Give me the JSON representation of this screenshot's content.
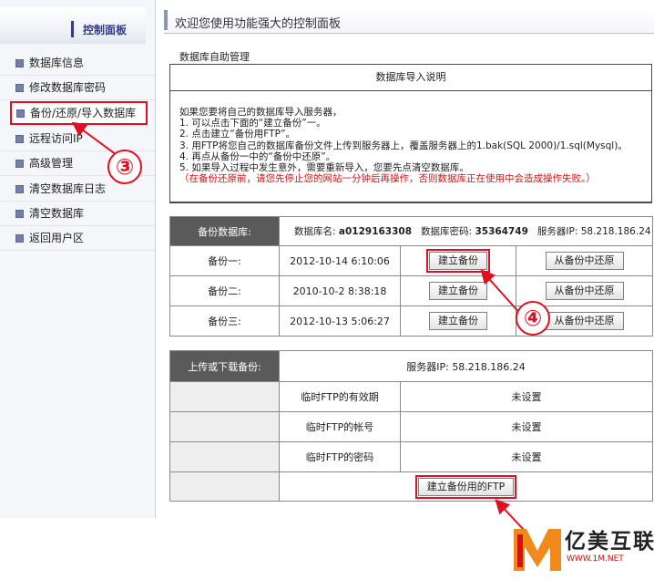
{
  "sidebar": {
    "title": "控制面板",
    "items": [
      {
        "label": "数据库信息"
      },
      {
        "label": "修改数据库密码"
      },
      {
        "label": "备份/还原/导入数据库"
      },
      {
        "label": "远程访问IP"
      },
      {
        "label": "高级管理"
      },
      {
        "label": "清空数据库日志"
      },
      {
        "label": "清空数据库"
      },
      {
        "label": "返回用户区"
      }
    ]
  },
  "header": {
    "title": "欢迎您使用功能强大的控制面板"
  },
  "section_title": "数据库自助管理",
  "import_info": {
    "heading": "数据库导入说明",
    "lines": [
      "如果您要将自己的数据库导入服务器，",
      "1. 可以点击下面的“建立备份”一。",
      "2. 点击建立“备份用FTP”。",
      "3. 用FTP将您自己的数据库备份文件上传到服务器上，覆盖服务器上的1.bak(SQL 2000)/1.sql(Mysql)。",
      "4. 再点从备份一中的“备份中还原”。",
      "5. 如果导入过程中发生意外，需要重新导入，您要先点清空数据库。"
    ],
    "warning": "（在备份还原前，请您先停止您的网站一分钟后再操作，否则数据库正在使用中会造成操作失败。）"
  },
  "backup": {
    "label": "备份数据库:",
    "db_name_label": "数据库名:",
    "db_name": "a0129163308",
    "db_password_label": "数据库密码:",
    "db_password": "35364749",
    "server_ip_label": "服务器IP:",
    "server_ip": "58.218.186.24",
    "create_label": "建立备份",
    "restore_label": "从备份中还原",
    "rows": [
      {
        "name": "备份一:",
        "time": "2012-10-14 6:10:06"
      },
      {
        "name": "备份二:",
        "time": "2010-10-2 8:38:18"
      },
      {
        "name": "备份三:",
        "time": "2012-10-13 5:06:27"
      }
    ]
  },
  "ftp": {
    "label": "上传或下载备份:",
    "server_label": "服务器IP:",
    "server_ip": "58.218.186.24",
    "rows": [
      {
        "name": "临时FTP的有效期",
        "value": "未设置"
      },
      {
        "name": "临时FTP的帐号",
        "value": "未设置"
      },
      {
        "name": "临时FTP的密码",
        "value": "未设置"
      }
    ],
    "create_button": "建立备份用的FTP"
  },
  "annotations": {
    "step3": "③",
    "step4": "④"
  },
  "logo": {
    "brand": "亿美互联",
    "url": "WWW.1M.NET"
  }
}
